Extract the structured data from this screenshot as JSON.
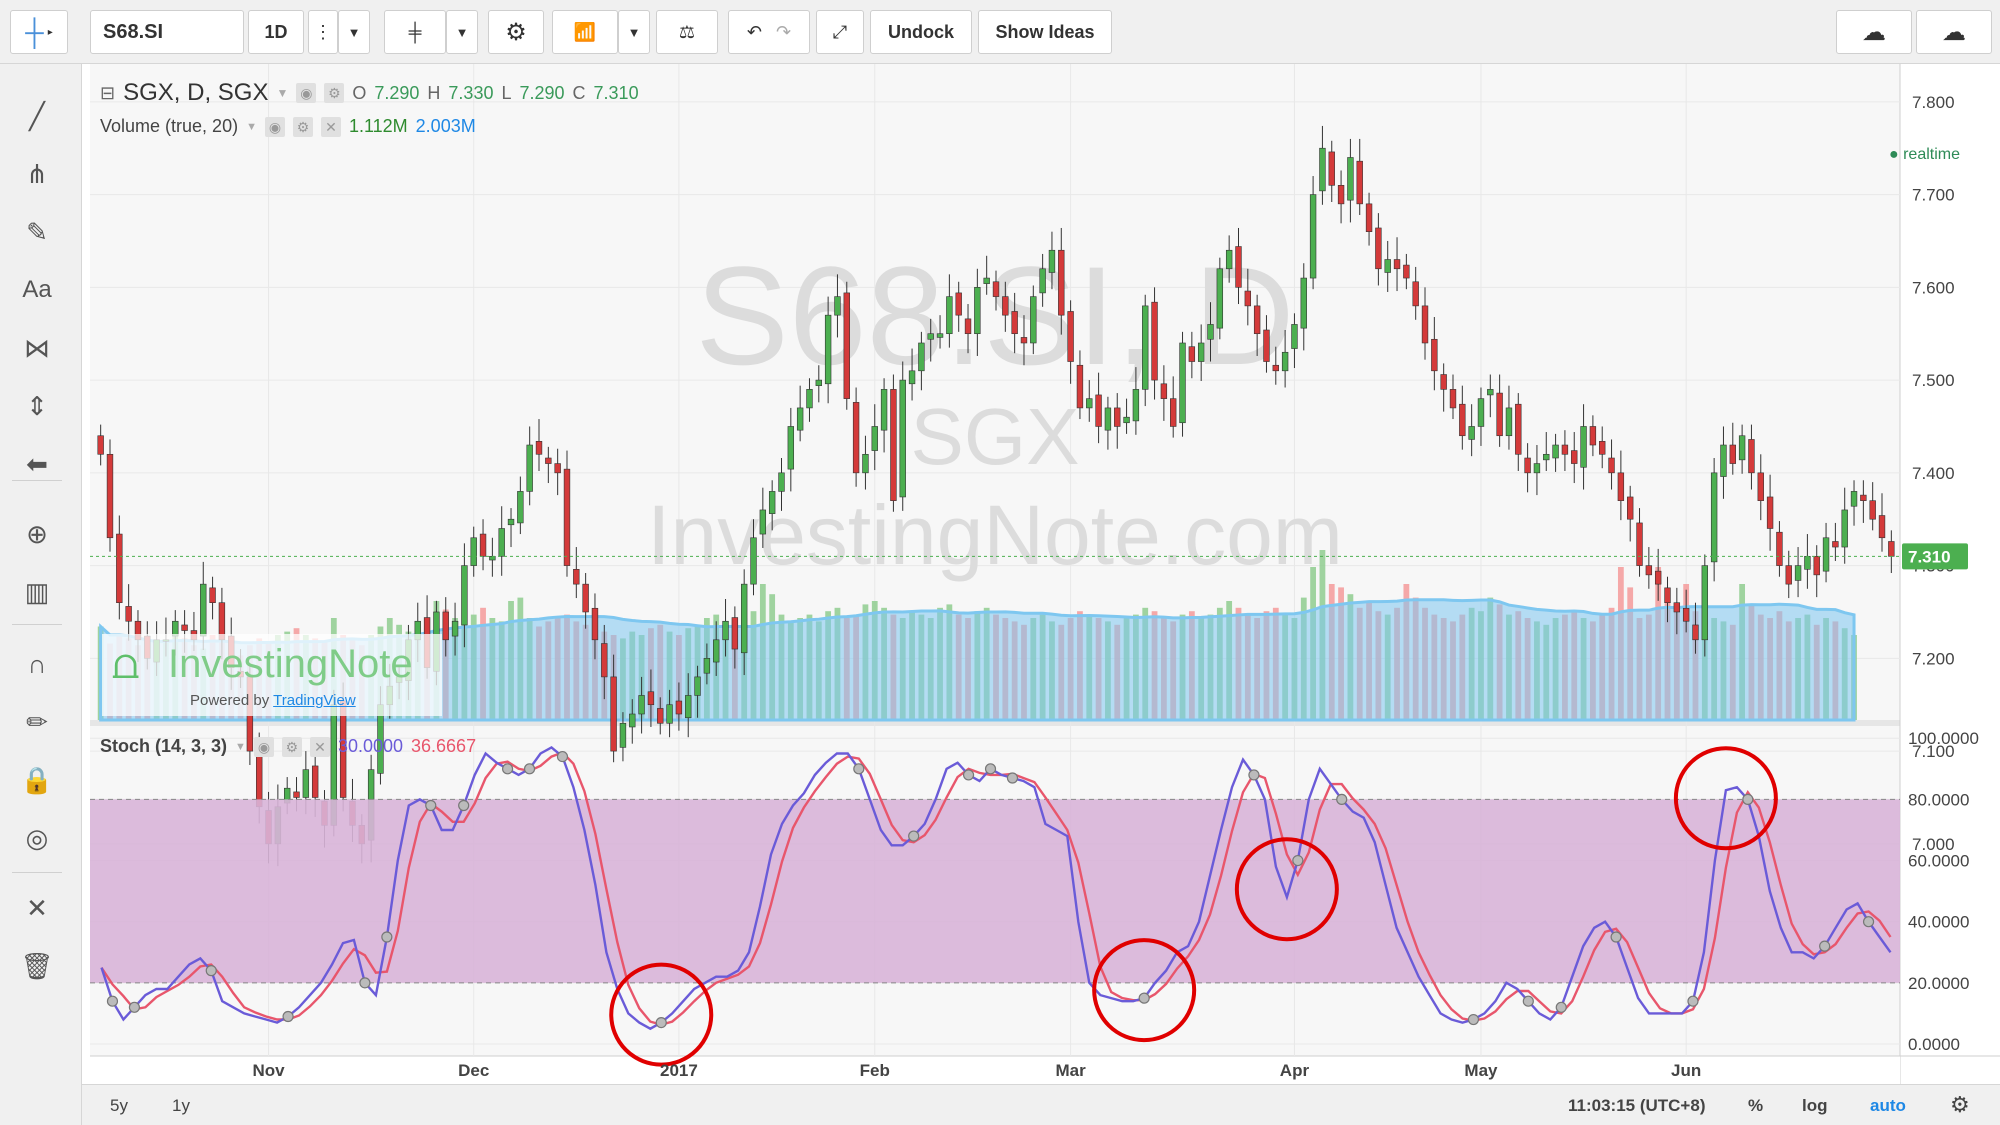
{
  "toolbar": {
    "symbol": "S68.SI",
    "interval": "1D",
    "undock_label": "Undock",
    "show_ideas_label": "Show Ideas"
  },
  "legend": {
    "title": "SGX, D, SGX",
    "o_label": "O",
    "o_value": "7.290",
    "h_label": "H",
    "h_value": "7.330",
    "l_label": "L",
    "l_value": "7.290",
    "c_label": "C",
    "c_value": "7.310",
    "volume_label": "Volume (true, 20)",
    "volume_value": "1.112M",
    "volume_ma_value": "2.003M",
    "realtime_label": "realtime",
    "stoch_label": "Stoch (14, 3, 3)",
    "stoch_k_value": "30.0000",
    "stoch_d_value": "36.6667"
  },
  "watermark": {
    "line1": "S68.SI, D",
    "line2": "SGX",
    "line3": "InvestingNote.com",
    "logo_text": "InvestingNote",
    "powered_by": "Powered by",
    "powered_brand": "TradingView"
  },
  "bottombar": {
    "range_5y": "5y",
    "range_1y": "1y",
    "time": "11:03:15 (UTC+8)",
    "percent": "%",
    "log": "log",
    "auto": "auto"
  },
  "colors": {
    "up": "#4caf50",
    "down": "#d43a3a",
    "volume_up": "#8fcc8f",
    "volume_down": "#f59a9a",
    "volume_ma": "#7ec7f0",
    "stoch_k": "#6a5bd8",
    "stoch_d": "#e8566c",
    "stoch_band": "#d8b4d8",
    "highlight_circle": "#e00000",
    "price_label_bg": "#4caf50",
    "auto_text": "#1e88e5"
  },
  "chart_data": {
    "type": "candlestick",
    "price_axis": {
      "ylim": [
        7.14,
        7.83
      ],
      "ticks": [
        "7.800",
        "7.700",
        "7.600",
        "7.500",
        "7.400",
        "7.300",
        "7.200",
        "7.100",
        "7.000"
      ],
      "last_price_label": "7.310"
    },
    "time_axis": {
      "labels": [
        "Nov",
        "Dec",
        "2017",
        "Feb",
        "Mar",
        "Apr",
        "May",
        "Jun"
      ]
    },
    "stoch_axis": {
      "ylim": [
        0,
        100
      ],
      "ticks": [
        "100.0000",
        "80.0000",
        "60.0000",
        "40.0000",
        "20.0000",
        "0.0000"
      ]
    },
    "price_close": [
      7.42,
      7.33,
      7.26,
      7.24,
      7.22,
      7.2,
      7.22,
      7.22,
      7.24,
      7.23,
      7.22,
      7.28,
      7.26,
      7.22,
      7.19,
      7.18,
      7.1,
      7.04,
      7.0,
      7.04,
      7.06,
      7.05,
      7.08,
      7.05,
      7.02,
      7.15,
      7.05,
      7.02,
      7.0,
      7.08,
      7.15,
      7.17,
      7.18,
      7.22,
      7.24,
      7.19,
      7.25,
      7.22,
      7.24,
      7.3,
      7.33,
      7.31,
      7.31,
      7.34,
      7.35,
      7.38,
      7.43,
      7.42,
      7.41,
      7.4,
      7.3,
      7.28,
      7.25,
      7.22,
      7.18,
      7.1,
      7.13,
      7.14,
      7.16,
      7.15,
      7.13,
      7.15,
      7.14,
      7.16,
      7.18,
      7.2,
      7.22,
      7.24,
      7.21,
      7.28,
      7.33,
      7.36,
      7.38,
      7.4,
      7.45,
      7.47,
      7.49,
      7.5,
      7.57,
      7.59,
      7.48,
      7.4,
      7.42,
      7.45,
      7.49,
      7.37,
      7.5,
      7.51,
      7.54,
      7.55,
      7.55,
      7.59,
      7.57,
      7.55,
      7.6,
      7.61,
      7.59,
      7.57,
      7.55,
      7.54,
      7.59,
      7.62,
      7.64,
      7.57,
      7.52,
      7.47,
      7.48,
      7.45,
      7.47,
      7.45,
      7.46,
      7.49,
      7.58,
      7.5,
      7.48,
      7.45,
      7.54,
      7.52,
      7.54,
      7.56,
      7.62,
      7.64,
      7.6,
      7.58,
      7.55,
      7.52,
      7.51,
      7.53,
      7.56,
      7.61,
      7.7,
      7.75,
      7.71,
      7.69,
      7.74,
      7.69,
      7.66,
      7.62,
      7.63,
      7.62,
      7.61,
      7.58,
      7.54,
      7.51,
      7.49,
      7.47,
      7.44,
      7.45,
      7.48,
      7.49,
      7.44,
      7.47,
      7.42,
      7.4,
      7.41,
      7.42,
      7.43,
      7.42,
      7.41,
      7.45,
      7.43,
      7.42,
      7.4,
      7.37,
      7.35,
      7.3,
      7.29,
      7.28,
      7.26,
      7.25,
      7.24,
      7.22,
      7.3,
      7.4,
      7.43,
      7.41,
      7.44,
      7.4,
      7.37,
      7.34,
      7.3,
      7.28,
      7.3,
      7.31,
      7.29,
      7.33,
      7.32,
      7.36,
      7.38,
      7.37,
      7.35,
      7.33,
      7.31
    ],
    "volume_relative": [
      0.55,
      0.45,
      0.5,
      0.48,
      0.44,
      0.4,
      0.42,
      0.46,
      0.5,
      0.48,
      0.44,
      0.42,
      0.5,
      0.46,
      0.4,
      0.38,
      0.44,
      0.48,
      0.46,
      0.5,
      0.52,
      0.54,
      0.5,
      0.48,
      0.46,
      0.6,
      0.5,
      0.48,
      0.44,
      0.5,
      0.55,
      0.6,
      0.56,
      0.52,
      0.54,
      0.6,
      0.7,
      0.65,
      0.6,
      0.58,
      0.62,
      0.66,
      0.6,
      0.58,
      0.7,
      0.72,
      0.6,
      0.55,
      0.58,
      0.6,
      0.62,
      0.58,
      0.56,
      0.54,
      0.52,
      0.5,
      0.48,
      0.52,
      0.5,
      0.54,
      0.56,
      0.52,
      0.5,
      0.54,
      0.56,
      0.6,
      0.62,
      0.58,
      0.56,
      0.6,
      0.64,
      0.8,
      0.74,
      0.62,
      0.58,
      0.6,
      0.62,
      0.58,
      0.64,
      0.66,
      0.6,
      0.62,
      0.68,
      0.7,
      0.66,
      0.62,
      0.6,
      0.64,
      0.62,
      0.6,
      0.66,
      0.68,
      0.62,
      0.6,
      0.64,
      0.66,
      0.62,
      0.6,
      0.58,
      0.56,
      0.6,
      0.62,
      0.58,
      0.56,
      0.6,
      0.64,
      0.62,
      0.6,
      0.58,
      0.56,
      0.6,
      0.62,
      0.66,
      0.64,
      0.6,
      0.58,
      0.62,
      0.64,
      0.6,
      0.62,
      0.66,
      0.7,
      0.66,
      0.62,
      0.6,
      0.64,
      0.66,
      0.62,
      0.6,
      0.72,
      0.9,
      1.0,
      0.8,
      0.78,
      0.74,
      0.66,
      0.7,
      0.64,
      0.62,
      0.66,
      0.8,
      0.72,
      0.66,
      0.62,
      0.6,
      0.58,
      0.62,
      0.66,
      0.64,
      0.72,
      0.68,
      0.62,
      0.64,
      0.6,
      0.58,
      0.56,
      0.6,
      0.62,
      0.64,
      0.6,
      0.58,
      0.62,
      0.66,
      0.9,
      0.78,
      0.6,
      0.62,
      0.9,
      0.74,
      0.66,
      0.8,
      0.64,
      0.62,
      0.6,
      0.58,
      0.56,
      0.8,
      0.68,
      0.62,
      0.6,
      0.64,
      0.58,
      0.6,
      0.62,
      0.56,
      0.6,
      0.58,
      0.54,
      0.5
    ],
    "stoch_k": [
      25,
      14,
      8,
      12,
      16,
      18,
      18,
      22,
      26,
      28,
      24,
      14,
      12,
      10,
      9,
      8,
      7,
      9,
      12,
      16,
      20,
      26,
      33,
      34,
      20,
      16,
      35,
      60,
      78,
      80,
      78,
      70,
      70,
      78,
      88,
      95,
      92,
      90,
      88,
      90,
      95,
      97,
      94,
      84,
      70,
      52,
      30,
      18,
      10,
      7,
      5,
      7,
      10,
      14,
      18,
      20,
      22,
      22,
      24,
      30,
      45,
      62,
      72,
      78,
      82,
      88,
      92,
      95,
      95,
      90,
      80,
      70,
      65,
      65,
      68,
      72,
      80,
      90,
      92,
      88,
      86,
      90,
      88,
      87,
      86,
      84,
      72,
      70,
      68,
      40,
      20,
      16,
      15,
      14,
      14,
      15,
      20,
      24,
      30,
      32,
      40,
      55,
      70,
      84,
      93,
      88,
      80,
      58,
      48,
      60,
      80,
      90,
      85,
      80,
      76,
      74,
      66,
      52,
      38,
      30,
      22,
      16,
      10,
      8,
      7,
      8,
      10,
      14,
      20,
      18,
      14,
      10,
      8,
      12,
      22,
      32,
      38,
      40,
      35,
      25,
      15,
      10,
      10,
      10,
      10,
      14,
      30,
      60,
      83,
      84,
      80,
      68,
      50,
      38,
      30,
      30,
      28,
      32,
      38,
      44,
      46,
      40,
      35,
      30
    ]
  }
}
